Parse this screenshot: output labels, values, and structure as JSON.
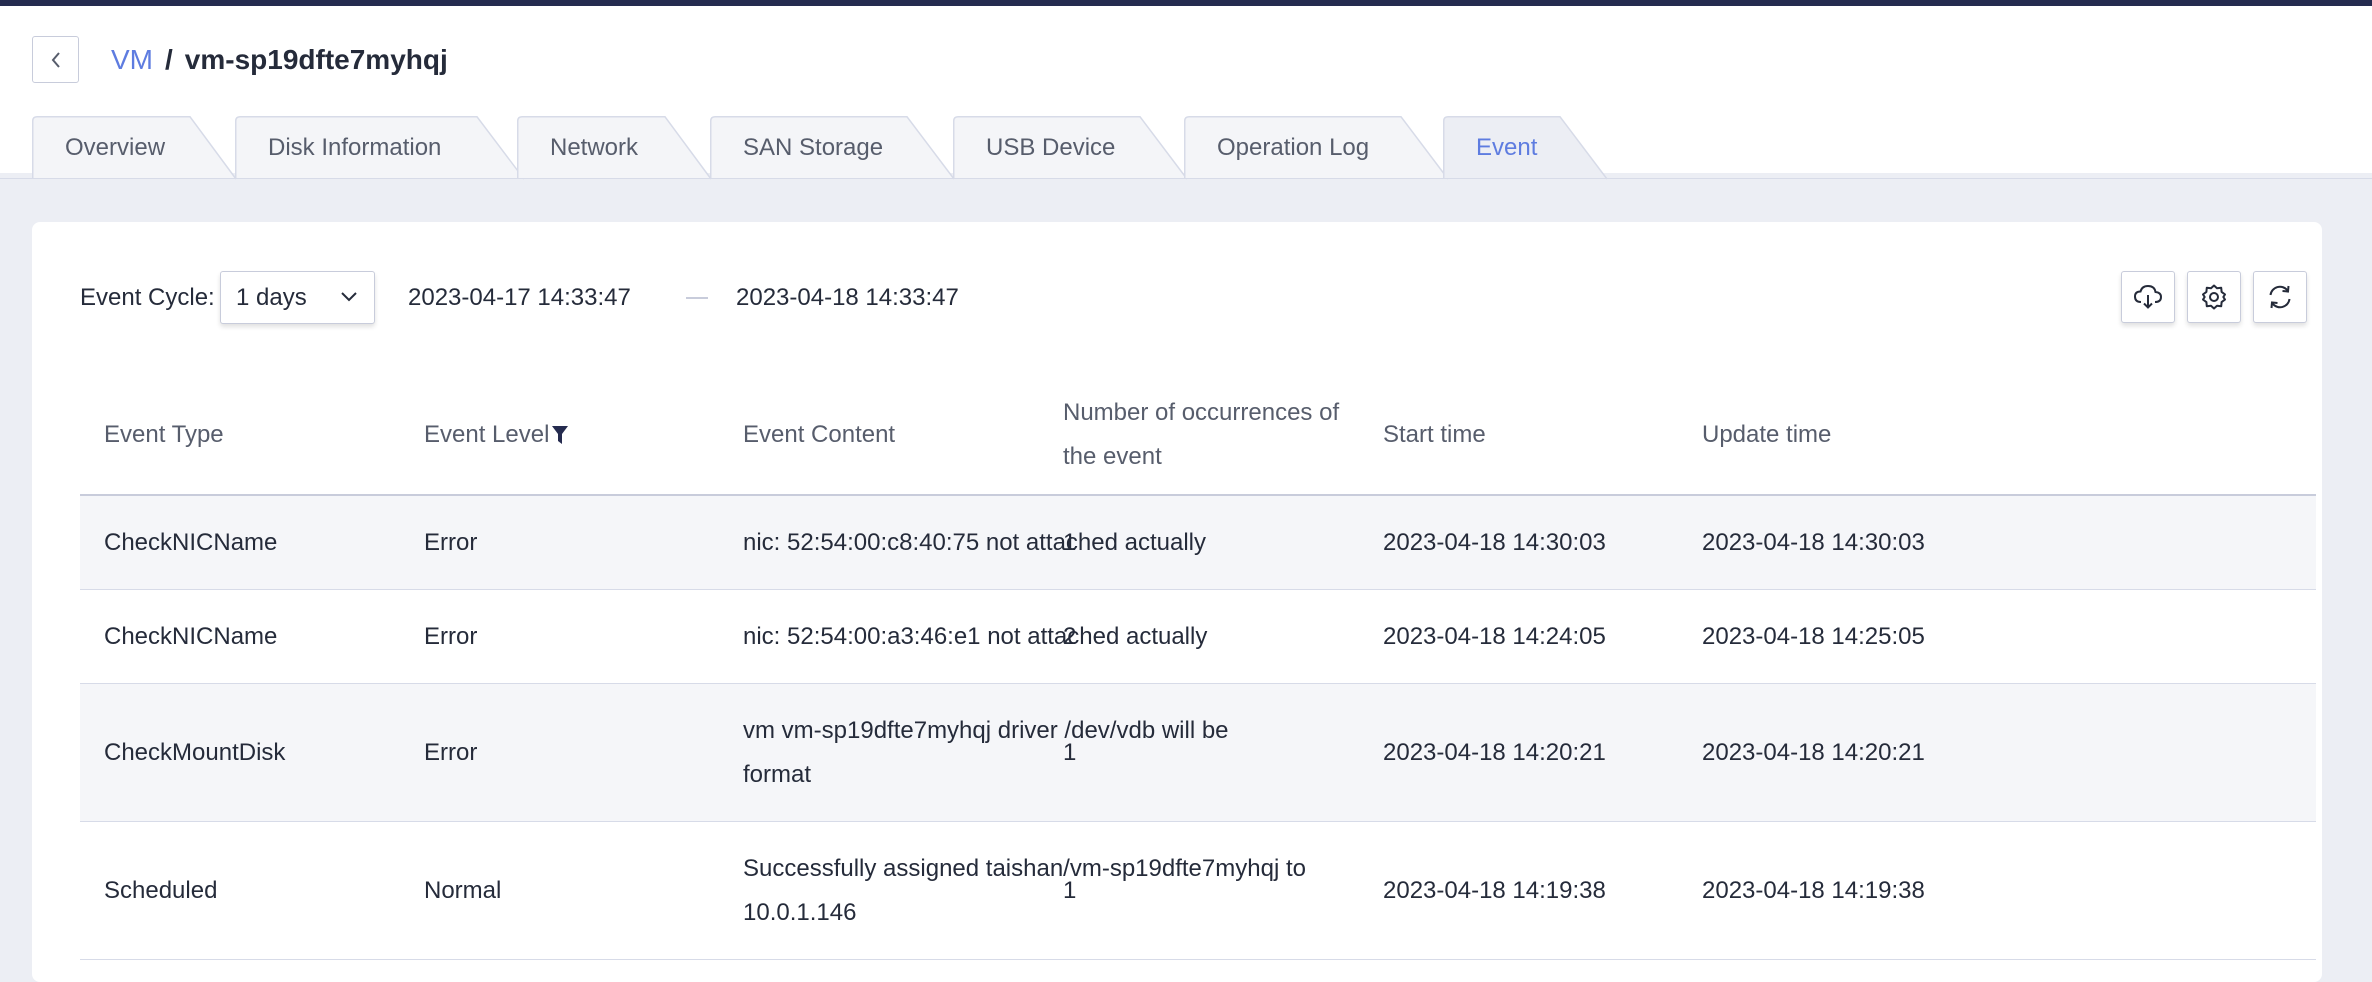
{
  "breadcrumb": {
    "parent": "VM",
    "separator": "/",
    "current": "vm-sp19dfte7myhqj"
  },
  "tabs": [
    {
      "label": "Overview",
      "active": false
    },
    {
      "label": "Disk Information",
      "active": false
    },
    {
      "label": "Network",
      "active": false
    },
    {
      "label": "SAN Storage",
      "active": false
    },
    {
      "label": "USB Device",
      "active": false
    },
    {
      "label": "Operation Log",
      "active": false
    },
    {
      "label": "Event",
      "active": true
    }
  ],
  "filters": {
    "event_cycle_label": "Event Cycle:",
    "event_cycle_value": "1 days",
    "start_date": "2023-04-17 14:33:47",
    "end_date": "2023-04-18 14:33:47"
  },
  "toolbar": {
    "download_icon": "cloud-download-icon",
    "settings_icon": "gear-icon",
    "refresh_icon": "refresh-icon"
  },
  "table": {
    "columns": [
      "Event Type",
      "Event Level",
      "Event Content",
      "Number of occurrences of the event",
      "Start time",
      "Update time"
    ],
    "rows": [
      {
        "type": "CheckNICName",
        "level": "Error",
        "content": "nic: 52:54:00:c8:40:75 not attached actually",
        "count": "1",
        "start": "2023-04-18 14:30:03",
        "update": "2023-04-18 14:30:03"
      },
      {
        "type": "CheckNICName",
        "level": "Error",
        "content": "nic: 52:54:00:a3:46:e1 not attached actually",
        "count": "2",
        "start": "2023-04-18 14:24:05",
        "update": "2023-04-18 14:25:05"
      },
      {
        "type": "CheckMountDisk",
        "level": "Error",
        "content": "vm vm-sp19dfte7myhqj driver /dev/vdb will be format",
        "count": "1",
        "start": "2023-04-18 14:20:21",
        "update": "2023-04-18 14:20:21"
      },
      {
        "type": "Scheduled",
        "level": "Normal",
        "content": "Successfully assigned taishan/vm-sp19dfte7myhqj to 10.0.1.146",
        "count": "1",
        "start": "2023-04-18 14:19:38",
        "update": "2023-04-18 14:19:38"
      }
    ]
  },
  "colors": {
    "accent": "#5e7ce0",
    "topbar": "#252b4f",
    "text": "#252b3a",
    "muted": "#575d6c"
  }
}
